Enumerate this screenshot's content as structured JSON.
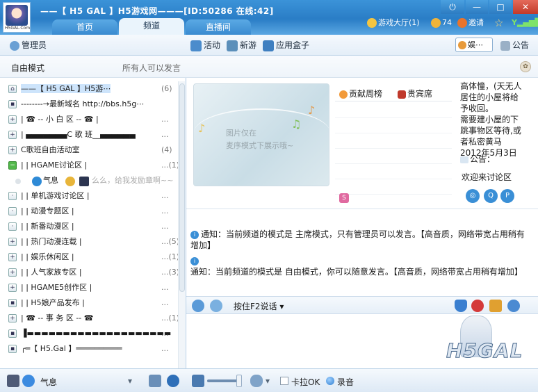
{
  "titlebar": {
    "room_title": "——【 H5 GAL 】H5游戏网———[ID:50286 在线:42]",
    "avatar_caption": "H5GAL.Com",
    "power": "⏻",
    "min": "—",
    "max": "□",
    "close": "✕"
  },
  "tabs": [
    {
      "label": "首页"
    },
    {
      "label": "频道"
    },
    {
      "label": "直播间"
    }
  ],
  "right_tools": {
    "hall": "游戏大厅(1)",
    "coins": "74",
    "invite": "邀请",
    "star": "☆",
    "signal": "Y"
  },
  "toolbar": {
    "admin": "管理员",
    "activity": "活动",
    "newgame": "新游",
    "appbox": "应用盒子",
    "entertain": "娱⋯",
    "announce": "公告"
  },
  "left": {
    "mode": "自由模式",
    "mode_right": "所有人可以发言",
    "rows": [
      {
        "name": "——【 H5 GAL 】H5游⋯",
        "cnt": "(6)"
      },
      {
        "name": "--------→最新域名 http://bbs.h5g⋯",
        "cnt": ""
      },
      {
        "name": "|    ☎ -- 小 白 区 -- ☎    |",
        "cnt": "..."
      },
      {
        "name": "|   ▄▄▄▄▄▄▄C 歌 班__▄▄▄▄▄▄",
        "cnt": "..."
      },
      {
        "name": "          C歌班自由活动室",
        "cnt": "(4)"
      },
      {
        "name": "|          |   HGAME讨论区   |",
        "cnt": "...(1)"
      },
      {
        "name": "气息",
        "cnt": ""
      },
      {
        "name": "|          | 单机游戏讨论区  |",
        "cnt": "..."
      },
      {
        "name": "|          |  动漫专题区   |",
        "cnt": "..."
      },
      {
        "name": "|          |  新番动漫区   |",
        "cnt": "..."
      },
      {
        "name": "|          | 热门动漫连载  |",
        "cnt": "...(5)"
      },
      {
        "name": "|          |   娱乐休闲区   |",
        "cnt": "...(1)"
      },
      {
        "name": "|          |  人气家族专区  |",
        "cnt": "...(3)"
      },
      {
        "name": "|          | HGAME5创作区  |",
        "cnt": "..."
      },
      {
        "name": "|          | H5娘产品发布  |",
        "cnt": "..."
      },
      {
        "name": "|     ☎ -- 事 务 区 -- ☎",
        "cnt": "...(1)"
      },
      {
        "name": "▐▬▬▬▬▬▬▬▬▬▬▬▬▬▬▬▬▬▬▬▬",
        "cnt": "..."
      },
      {
        "name": "╭═【 H5.Gal 】══════════",
        "cnt": "..."
      }
    ],
    "user_status": "么么，给我发励章啊~~"
  },
  "right": {
    "media_line1": "图片仅在",
    "media_line2": "麦序模式下展示哦~",
    "rank_tab1": "贡献周榜",
    "rank_tab2": "贵宾席",
    "s_badge": "S",
    "side_text": "高体憧，(天无人\n居住的小屋将给\n予收回。\n需要建小屋的下\n跳事物区等待,或\n者私密黄马\n2012年5月3日",
    "announce_label": "公告：",
    "announce_text": "欢迎来讨论区",
    "messages": [
      "通知：当前频道的模式是 主席模式，只有管理员可以发言。【高音质，网络带宽占用稍有增加】",
      "通知：当前频道的模式是 自由模式，你可以随意发言。【高音质，网络带宽占用稍有增加】"
    ],
    "ptt_label": "按住F2说话",
    "logo": "H5GAL"
  },
  "bottom": {
    "status": "气息",
    "karaoke": "卡拉OK",
    "record": "录音"
  }
}
